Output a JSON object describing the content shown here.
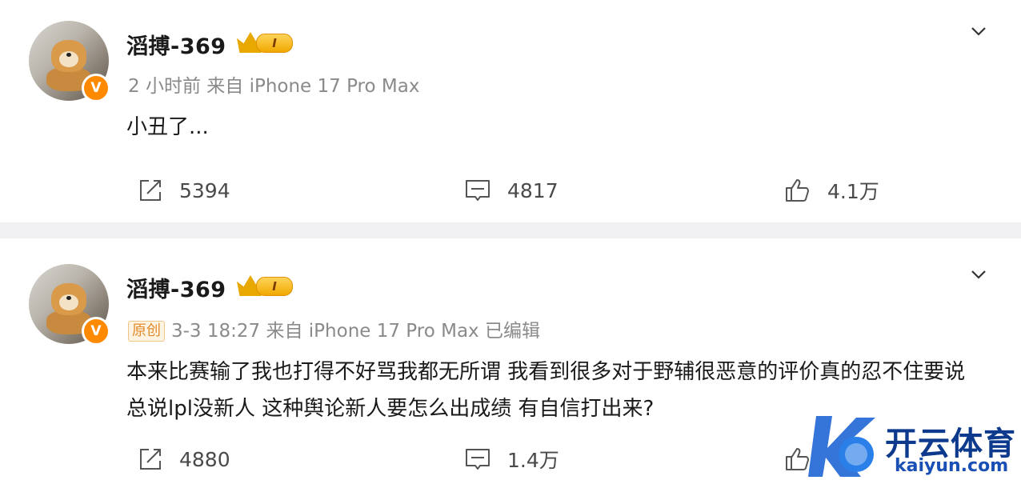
{
  "posts": [
    {
      "username": "滔搏-369",
      "level": "I",
      "meta": "2 小时前  来自 iPhone 17 Pro Max",
      "original_tag": "",
      "content": "小丑了...",
      "reposts": "5394",
      "comments": "4817",
      "likes": "4.1万"
    },
    {
      "username": "滔搏-369",
      "level": "I",
      "meta": "3-3 18:27  来自 iPhone 17 Pro Max 已编辑",
      "original_tag": "原创",
      "content": "本来比赛输了我也打得不好骂我都无所谓  我看到很多对于野辅很恶意的评价真的忍不住要说 总说lpl没新人 这种舆论新人要怎么出成绩 有自信打出来?",
      "reposts": "4880",
      "comments": "1.4万",
      "likes": ""
    }
  ],
  "verified_badge": "V",
  "watermark": {
    "cn": "开云体育",
    "en": "kaiyun.com"
  },
  "colors": {
    "verified": "#ff8a00",
    "watermark": "#0d3a8c",
    "background": "#f0f0f2"
  },
  "icons": [
    "repost-icon",
    "comment-icon",
    "like-icon",
    "chevron-down-icon",
    "crown-icon"
  ]
}
